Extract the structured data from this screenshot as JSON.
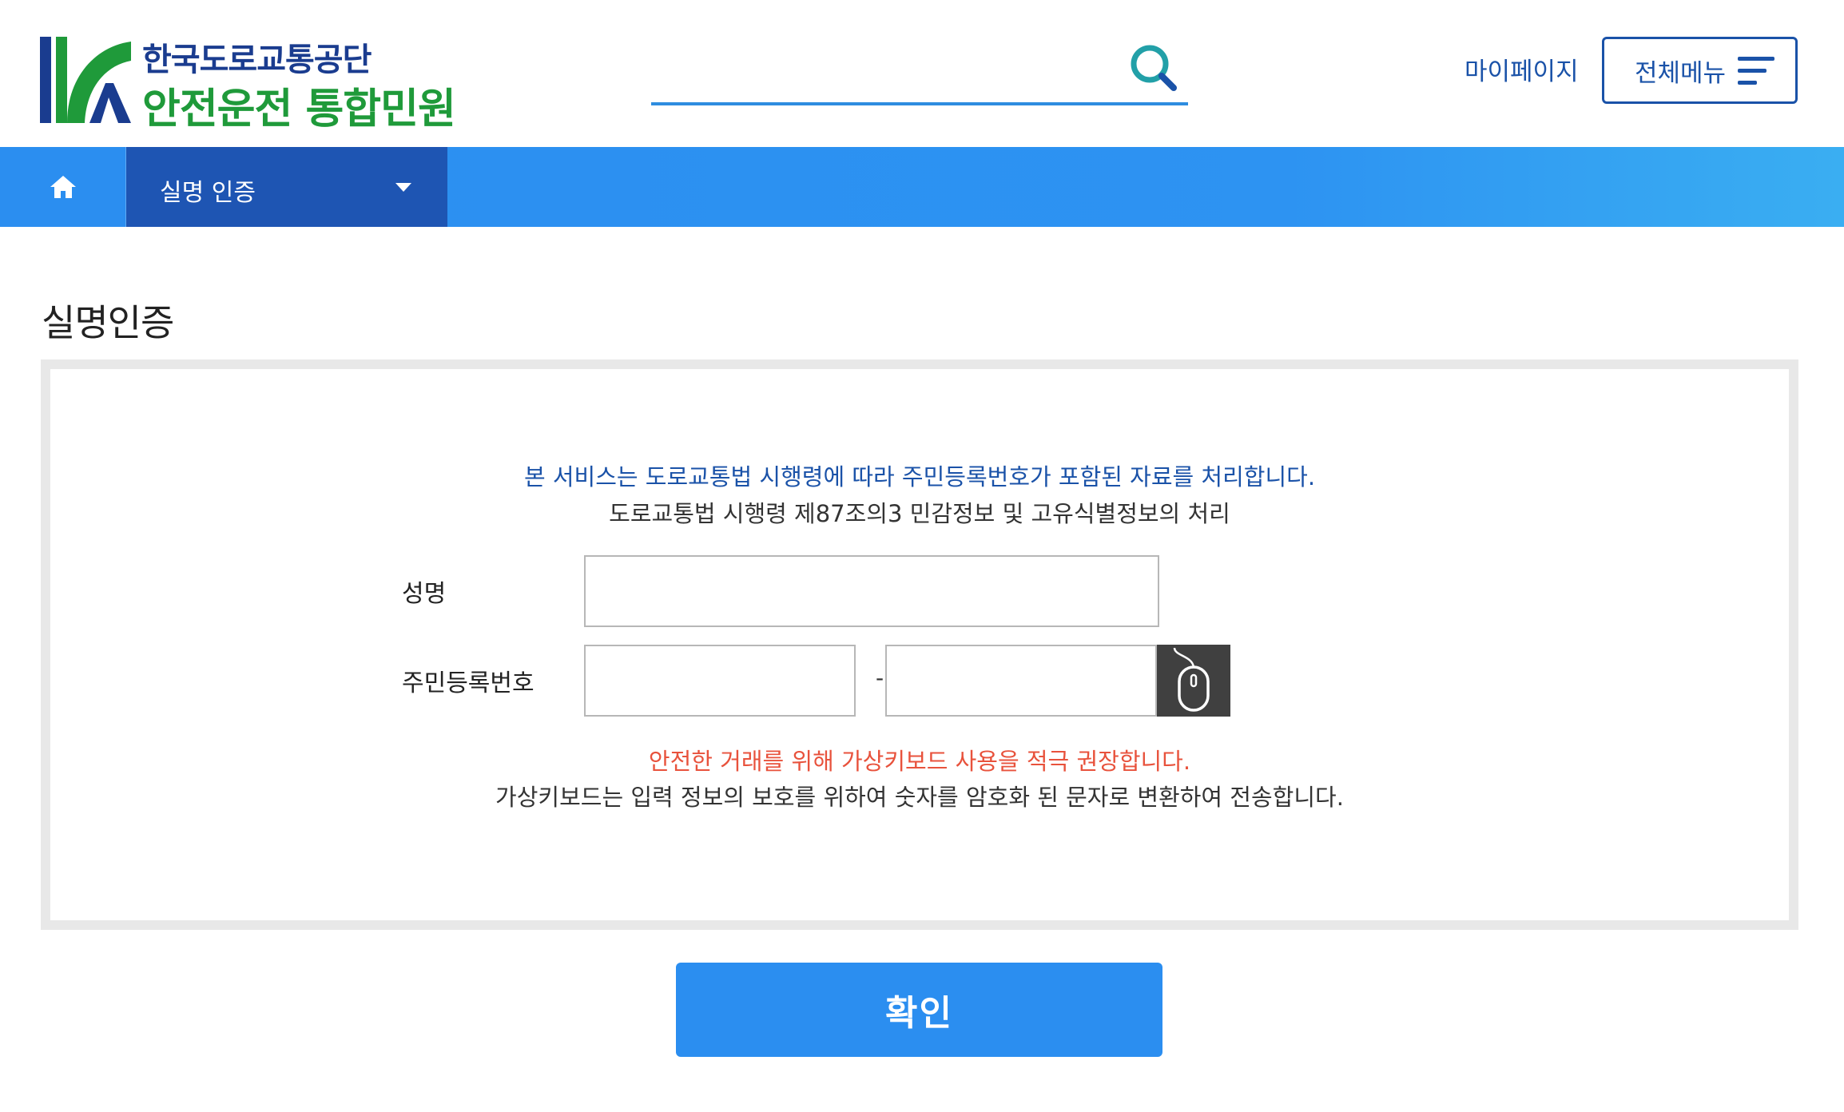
{
  "header": {
    "org_name": "한국도로교통공단",
    "service_name": "안전운전 통합민원",
    "search_placeholder": "",
    "mypage_label": "마이페이지",
    "allmenu_label": "전체메뉴"
  },
  "nav": {
    "home_icon": "home-icon",
    "dropdown_label": "실명 인증"
  },
  "content": {
    "page_title": "실명인증",
    "notice_blue": "본 서비스는 도로교통법 시행령에 따라 주민등록번호가 포함된 자료를 처리합니다.",
    "notice_black": "도로교통법 시행령 제87조의3 민감정보 및 고유식별정보의 처리",
    "name_label": "성명",
    "name_value": "",
    "rrn_label": "주민등록번호",
    "rrn_front_value": "",
    "rrn_separator": "-",
    "rrn_back_value": "",
    "vkbd_icon": "mouse-icon",
    "warning_red": "안전한 거래를 위해 가상키보드 사용을 적극 권장합니다.",
    "info_black": "가상키보드는 입력 정보의 보호를 위하여 숫자를 암호화 된 문자로 변환하여 전송합니다.",
    "confirm_label": "확인"
  },
  "colors": {
    "brand_blue": "#1a52a8",
    "brand_green": "#1f9a3a",
    "nav_blue": "#2b8ef0",
    "nav_dark": "#1e55b3",
    "warning_red": "#e8523c"
  }
}
